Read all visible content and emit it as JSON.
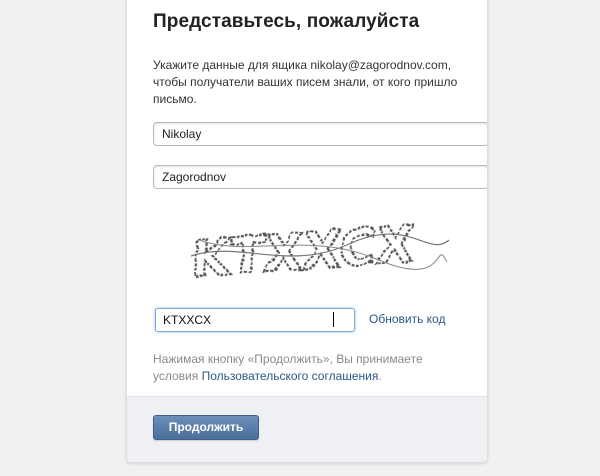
{
  "form": {
    "title": "Представьтесь, пожалуйста",
    "description": "Укажите данные для ящика nikolay@zagorodnov.com, чтобы получатели ваших писем знали, от кого пришло письмо.",
    "first_name_value": "Nikolay",
    "last_name_value": "Zagorodnov",
    "captcha_text": "KTXXCX",
    "captcha_value": "KTXXCX",
    "refresh_label": "Обновить код",
    "note_prefix": "Нажимая кнопку «Продолжить», Вы принимаете условия ",
    "note_link": "Пользовательского соглашения",
    "note_suffix": ".",
    "continue_label": "Продолжить"
  },
  "colors": {
    "page_bg": "#f1f1f1",
    "link": "#2a5885",
    "button": "#4a6f9b",
    "footer_bg": "#eef0f3"
  }
}
